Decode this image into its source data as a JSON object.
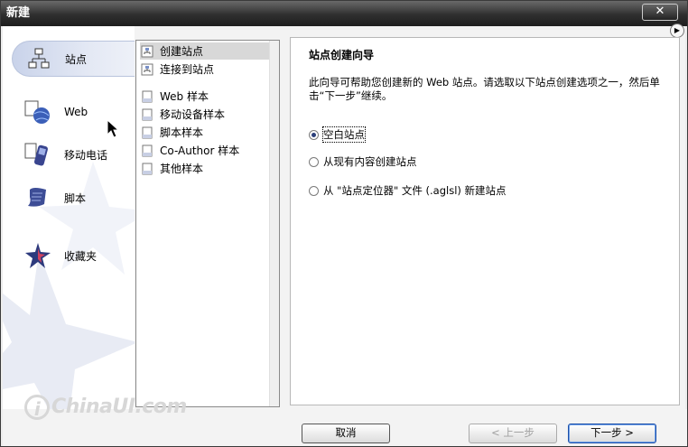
{
  "window": {
    "title": "新建",
    "close_glyph": "✕"
  },
  "nav": {
    "items": [
      {
        "label": "站点",
        "icon": "sitemap-icon",
        "selected": true
      },
      {
        "label": "Web",
        "icon": "web-globe-icon",
        "selected": false
      },
      {
        "label": "移动电话",
        "icon": "mobile-phone-icon",
        "selected": false
      },
      {
        "label": "脚本",
        "icon": "script-scroll-icon",
        "selected": false
      },
      {
        "label": "收藏夹",
        "icon": "favorites-star-icon",
        "selected": false
      }
    ]
  },
  "list": {
    "items": [
      {
        "label": "创建站点",
        "icon": "site-icon",
        "selected": true
      },
      {
        "label": "连接到站点",
        "icon": "site-icon",
        "selected": false
      },
      {
        "label": "Web 样本",
        "icon": "document-icon",
        "selected": false
      },
      {
        "label": "移动设备样本",
        "icon": "document-icon",
        "selected": false
      },
      {
        "label": "脚本样本",
        "icon": "document-icon",
        "selected": false
      },
      {
        "label": "Co-Author 样本",
        "icon": "document-icon",
        "selected": false
      },
      {
        "label": "其他样本",
        "icon": "document-icon",
        "selected": false
      }
    ]
  },
  "panel": {
    "title": "站点创建向导",
    "description": "此向导可帮助您创建新的 Web 站点。请选取以下站点创建选项之一，然后单击“下一步”继续。",
    "options": [
      {
        "label": "空白站点",
        "checked": true
      },
      {
        "label": "从现有内容创建站点",
        "checked": false
      },
      {
        "label": "从 \"站点定位器\" 文件 (.aglsl) 新建站点",
        "checked": false
      }
    ]
  },
  "buttons": {
    "cancel": "取消",
    "back": "< 上一步",
    "next": "下一步 >"
  },
  "watermark": {
    "text": "ChinaUI.com",
    "mark": "i"
  },
  "colors": {
    "title_bar": "#2f2f2f",
    "nav_selected": "#c9d3ea",
    "radio_dot": "#2b3f7a"
  }
}
